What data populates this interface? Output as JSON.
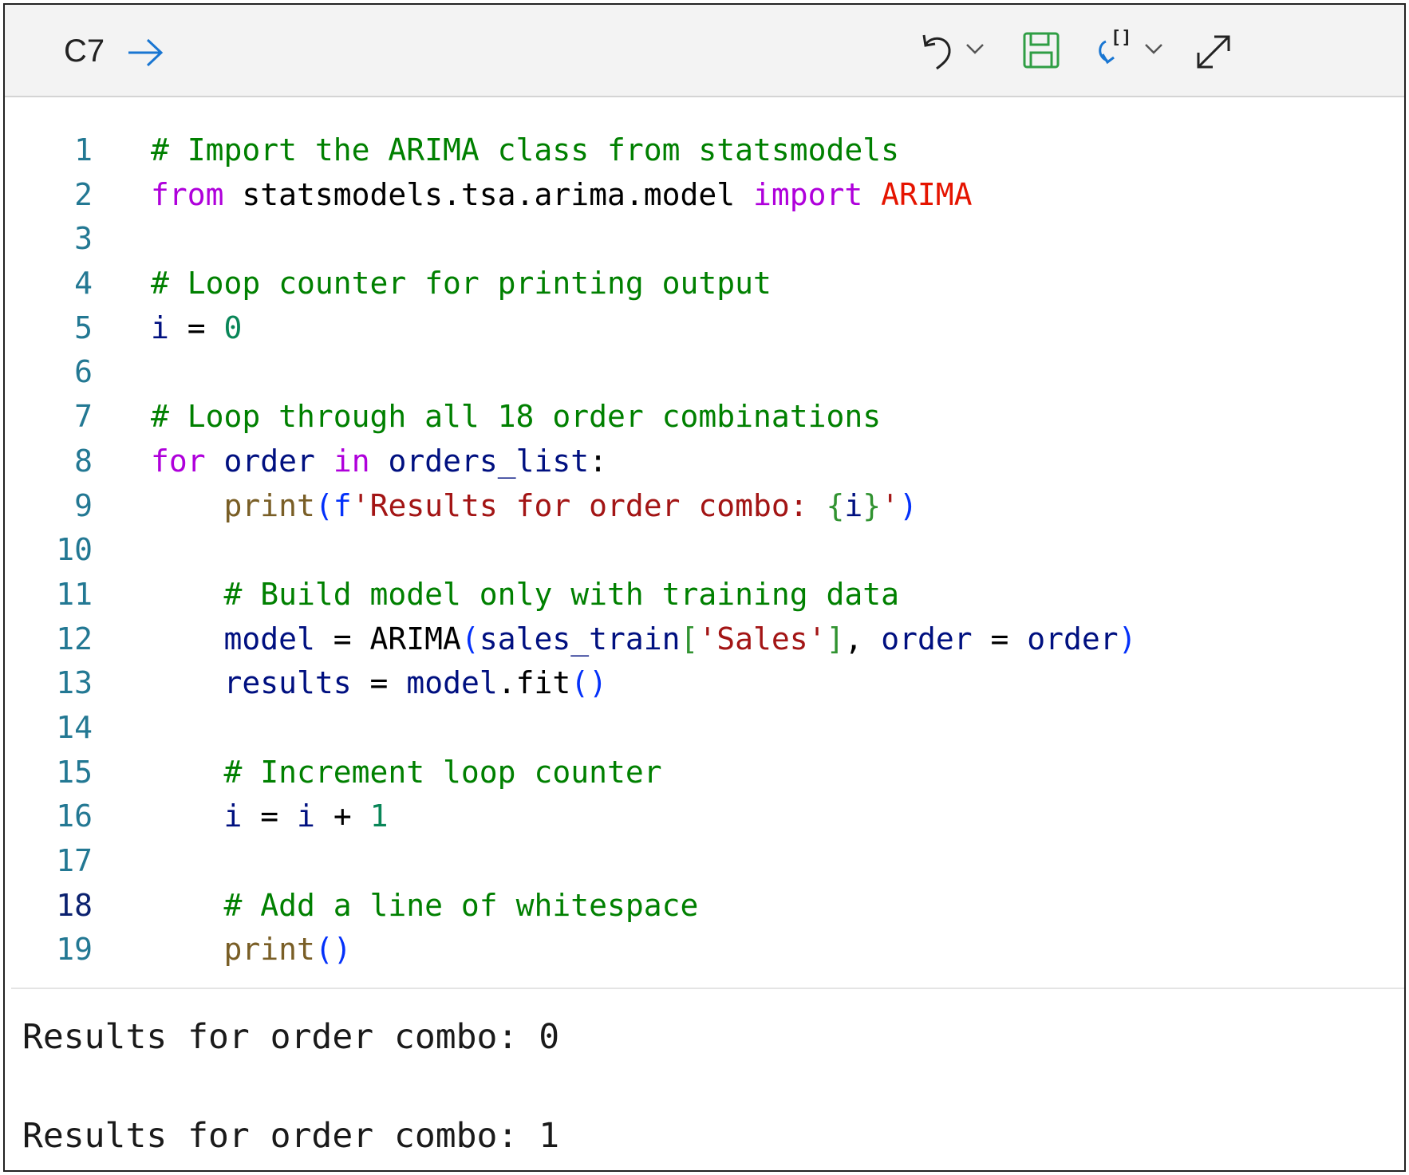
{
  "toolbar": {
    "cell_ref": "C7",
    "icons": [
      "arrow-right-icon",
      "undo-icon",
      "chevron-down-icon",
      "save-icon",
      "refresh-icon",
      "chevron-down-icon",
      "expand-icon"
    ]
  },
  "colors": {
    "comment": "#008000",
    "keyword": "#af00db",
    "variable": "#001080",
    "number": "#098658",
    "string": "#a31515",
    "function": "#795e26",
    "bracket_blue": "#0431fa",
    "bracket_green": "#319331",
    "class_red": "#e51400",
    "line_number": "#237893",
    "save_green": "#2f9e44",
    "refresh_blue": "#1976d2"
  },
  "code_lines": [
    {
      "n": "1",
      "tokens": [
        {
          "t": "# Import the ARIMA class from statsmodels",
          "k": "comment"
        }
      ]
    },
    {
      "n": "2",
      "tokens": [
        {
          "t": "from",
          "k": "keyword"
        },
        {
          "t": " statsmodels.tsa.arima.model ",
          "k": "plain"
        },
        {
          "t": "import",
          "k": "keyword"
        },
        {
          "t": " ",
          "k": "plain"
        },
        {
          "t": "ARIMA",
          "k": "class_red"
        }
      ]
    },
    {
      "n": "3",
      "tokens": []
    },
    {
      "n": "4",
      "tokens": [
        {
          "t": "# Loop counter for printing output",
          "k": "comment"
        }
      ]
    },
    {
      "n": "5",
      "tokens": [
        {
          "t": "i",
          "k": "variable"
        },
        {
          "t": " = ",
          "k": "plain"
        },
        {
          "t": "0",
          "k": "number"
        }
      ]
    },
    {
      "n": "6",
      "tokens": []
    },
    {
      "n": "7",
      "tokens": [
        {
          "t": "# Loop through all 18 order combinations",
          "k": "comment"
        }
      ]
    },
    {
      "n": "8",
      "tokens": [
        {
          "t": "for",
          "k": "keyword"
        },
        {
          "t": " ",
          "k": "plain"
        },
        {
          "t": "order",
          "k": "variable"
        },
        {
          "t": " ",
          "k": "plain"
        },
        {
          "t": "in",
          "k": "keyword"
        },
        {
          "t": " ",
          "k": "plain"
        },
        {
          "t": "orders_list",
          "k": "variable"
        },
        {
          "t": ":",
          "k": "plain"
        }
      ]
    },
    {
      "n": "9",
      "tokens": [
        {
          "t": "    ",
          "k": "plain"
        },
        {
          "t": "print",
          "k": "function"
        },
        {
          "t": "(",
          "k": "bracket_blue"
        },
        {
          "t": "f",
          "k": "bracket_blue"
        },
        {
          "t": "'Results for order combo: ",
          "k": "string"
        },
        {
          "t": "{",
          "k": "bracket_green"
        },
        {
          "t": "i",
          "k": "variable"
        },
        {
          "t": "}",
          "k": "bracket_green"
        },
        {
          "t": "'",
          "k": "string"
        },
        {
          "t": ")",
          "k": "bracket_blue"
        }
      ]
    },
    {
      "n": "10",
      "tokens": []
    },
    {
      "n": "11",
      "tokens": [
        {
          "t": "    ",
          "k": "plain"
        },
        {
          "t": "# Build model only with training data",
          "k": "comment"
        }
      ]
    },
    {
      "n": "12",
      "tokens": [
        {
          "t": "    ",
          "k": "plain"
        },
        {
          "t": "model",
          "k": "variable"
        },
        {
          "t": " = ARIMA",
          "k": "plain"
        },
        {
          "t": "(",
          "k": "bracket_blue"
        },
        {
          "t": "sales_train",
          "k": "variable"
        },
        {
          "t": "[",
          "k": "bracket_green"
        },
        {
          "t": "'Sales'",
          "k": "string"
        },
        {
          "t": "]",
          "k": "bracket_green"
        },
        {
          "t": ", ",
          "k": "plain"
        },
        {
          "t": "order",
          "k": "variable"
        },
        {
          "t": " = ",
          "k": "plain"
        },
        {
          "t": "order",
          "k": "variable"
        },
        {
          "t": ")",
          "k": "bracket_blue"
        }
      ]
    },
    {
      "n": "13",
      "tokens": [
        {
          "t": "    ",
          "k": "plain"
        },
        {
          "t": "results",
          "k": "variable"
        },
        {
          "t": " = ",
          "k": "plain"
        },
        {
          "t": "model",
          "k": "variable"
        },
        {
          "t": ".fit",
          "k": "plain"
        },
        {
          "t": "()",
          "k": "bracket_blue"
        }
      ]
    },
    {
      "n": "14",
      "tokens": []
    },
    {
      "n": "15",
      "tokens": [
        {
          "t": "    ",
          "k": "plain"
        },
        {
          "t": "# Increment loop counter",
          "k": "comment"
        }
      ]
    },
    {
      "n": "16",
      "tokens": [
        {
          "t": "    ",
          "k": "plain"
        },
        {
          "t": "i",
          "k": "variable"
        },
        {
          "t": " = ",
          "k": "plain"
        },
        {
          "t": "i",
          "k": "variable"
        },
        {
          "t": " + ",
          "k": "plain"
        },
        {
          "t": "1",
          "k": "number"
        }
      ]
    },
    {
      "n": "17",
      "tokens": []
    },
    {
      "n": "18",
      "active": true,
      "tokens": [
        {
          "t": "    ",
          "k": "plain"
        },
        {
          "t": "# Add a line of whitespace",
          "k": "comment"
        }
      ]
    },
    {
      "n": "19",
      "tokens": [
        {
          "t": "    ",
          "k": "plain"
        },
        {
          "t": "print",
          "k": "function"
        },
        {
          "t": "()",
          "k": "bracket_blue"
        }
      ]
    }
  ],
  "output_lines": [
    "Results for order combo: 0",
    "Results for order combo: 1"
  ]
}
